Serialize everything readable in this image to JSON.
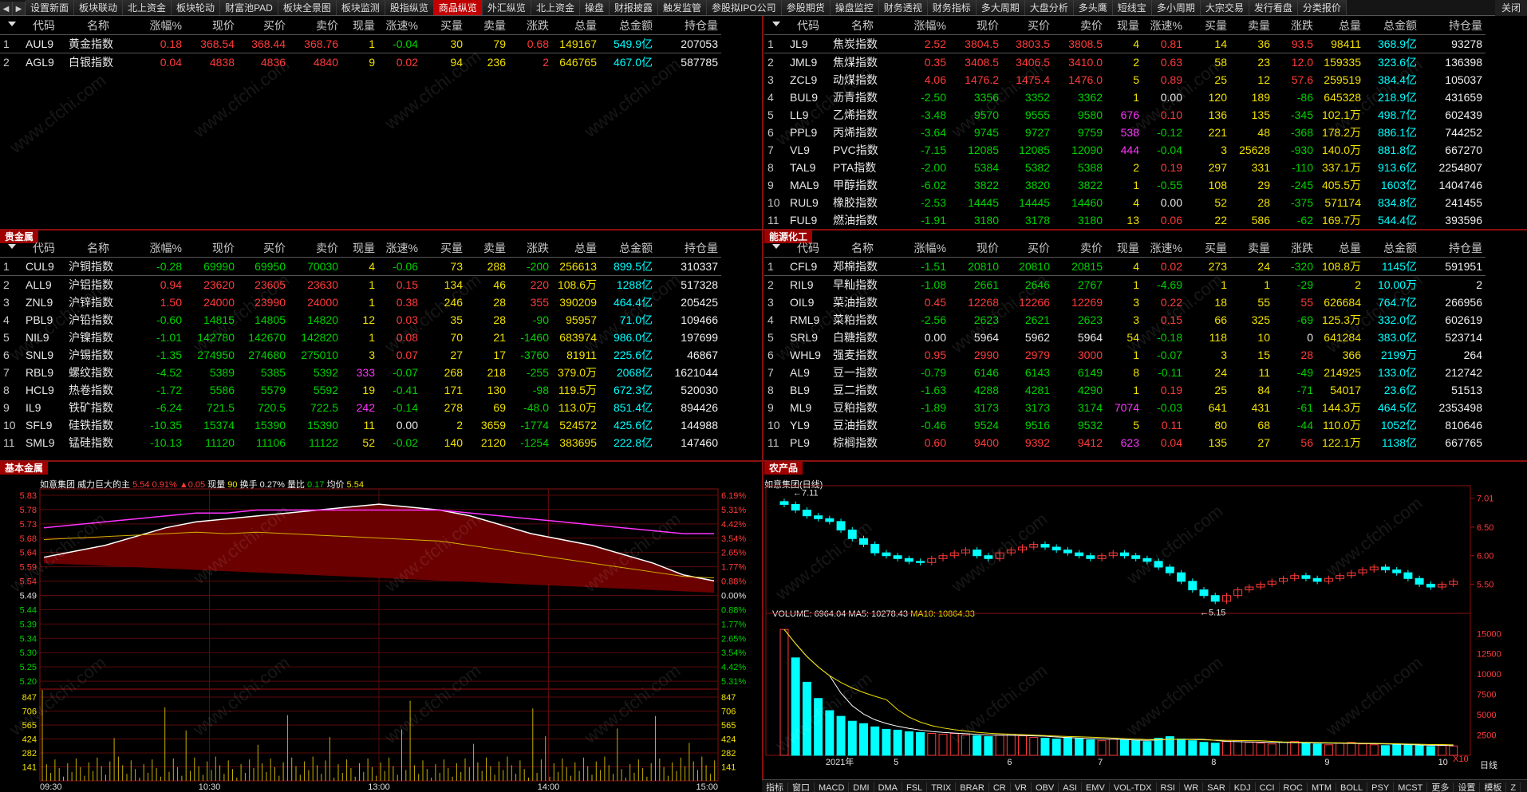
{
  "top_tabs": [
    "设置新面",
    "板块联动",
    "北上资金",
    "板块轮动",
    "财富池PAD",
    "板块全景图",
    "板块监测",
    "股指纵览",
    "商品纵览",
    "外汇纵览",
    "北上资金",
    "操盘",
    "财报披露",
    "触发监管",
    "参股拟IPO公司",
    "参股期货",
    "操盘监控",
    "财务透视",
    "财务指标",
    "多大周期",
    "大盘分析",
    "多头鹰",
    "短线宝",
    "多小周期",
    "大宗交易",
    "发行看盘",
    "分类报价"
  ],
  "active_tab": "商品纵览",
  "close_label": "关闭",
  "headers": {
    "idx": "",
    "code": "代码",
    "name": "名称",
    "chg_pct": "涨幅%",
    "price": "现价",
    "bid": "买价",
    "ask": "卖价",
    "vol_now": "现量",
    "speed": "涨速%",
    "buy_vol": "买量",
    "sell_vol": "卖量",
    "chg": "涨跌",
    "total_vol": "总量",
    "amount": "总金额",
    "oi": "持仓量"
  },
  "panels": {
    "gold": {
      "title": "",
      "rows": [
        [
          "1",
          "AUL9",
          "黄金指数",
          "0.18",
          "368.54",
          "368.44",
          "368.76",
          "1",
          "-0.04",
          "30",
          "79",
          "0.68",
          "149167",
          "549.9亿",
          "207053"
        ],
        [
          "2",
          "AGL9",
          "白银指数",
          "0.04",
          "4838",
          "4836",
          "4840",
          "9",
          "0.02",
          "94",
          "236",
          "2",
          "646765",
          "467.0亿",
          "587785"
        ]
      ]
    },
    "precious": {
      "title": "贵金属",
      "rows": [
        [
          "1",
          "CUL9",
          "沪铜指数",
          "-0.28",
          "69990",
          "69950",
          "70030",
          "4",
          "-0.06",
          "73",
          "288",
          "-200",
          "256613",
          "899.5亿",
          "310337"
        ],
        [
          "2",
          "ALL9",
          "沪铝指数",
          "0.94",
          "23620",
          "23605",
          "23630",
          "1",
          "0.15",
          "134",
          "46",
          "220",
          "108.6万",
          "1288亿",
          "517328"
        ],
        [
          "3",
          "ZNL9",
          "沪锌指数",
          "1.50",
          "24000",
          "23990",
          "24000",
          "1",
          "0.38",
          "246",
          "28",
          "355",
          "390209",
          "464.4亿",
          "205425"
        ],
        [
          "4",
          "PBL9",
          "沪铅指数",
          "-0.60",
          "14815",
          "14805",
          "14820",
          "12",
          "0.03",
          "35",
          "28",
          "-90",
          "95957",
          "71.0亿",
          "109466"
        ],
        [
          "5",
          "NIL9",
          "沪镍指数",
          "-1.01",
          "142780",
          "142670",
          "142820",
          "1",
          "0.08",
          "70",
          "21",
          "-1460",
          "683974",
          "986.0亿",
          "197699"
        ],
        [
          "6",
          "SNL9",
          "沪锡指数",
          "-1.35",
          "274950",
          "274680",
          "275010",
          "3",
          "0.07",
          "27",
          "17",
          "-3760",
          "81911",
          "225.6亿",
          "46867"
        ],
        [
          "7",
          "RBL9",
          "螺纹指数",
          "-4.52",
          "5389",
          "5385",
          "5392",
          "333",
          "-0.07",
          "268",
          "218",
          "-255",
          "379.0万",
          "2068亿",
          "1621044"
        ],
        [
          "8",
          "HCL9",
          "热卷指数",
          "-1.72",
          "5586",
          "5579",
          "5592",
          "19",
          "-0.41",
          "171",
          "130",
          "-98",
          "119.5万",
          "672.3亿",
          "520030"
        ],
        [
          "9",
          "IL9",
          "铁矿指数",
          "-6.24",
          "721.5",
          "720.5",
          "722.5",
          "242",
          "-0.14",
          "278",
          "69",
          "-48.0",
          "113.0万",
          "851.4亿",
          "894426"
        ],
        [
          "10",
          "SFL9",
          "硅铁指数",
          "-10.35",
          "15374",
          "15390",
          "15390",
          "11",
          "0.00",
          "2",
          "3659",
          "-1774",
          "524572",
          "425.6亿",
          "144988"
        ],
        [
          "11",
          "SML9",
          "锰硅指数",
          "-10.13",
          "11120",
          "11106",
          "11122",
          "52",
          "-0.02",
          "140",
          "2120",
          "-1254",
          "383695",
          "222.8亿",
          "147460"
        ]
      ]
    },
    "energy": {
      "title": "",
      "rows": [
        [
          "1",
          "JL9",
          "焦炭指数",
          "2.52",
          "3804.5",
          "3803.5",
          "3808.5",
          "4",
          "0.81",
          "14",
          "36",
          "93.5",
          "98411",
          "368.9亿",
          "93278"
        ],
        [
          "2",
          "JML9",
          "焦煤指数",
          "0.35",
          "3408.5",
          "3406.5",
          "3410.0",
          "2",
          "0.63",
          "58",
          "23",
          "12.0",
          "159335",
          "323.6亿",
          "136398"
        ],
        [
          "3",
          "ZCL9",
          "动煤指数",
          "4.06",
          "1476.2",
          "1475.4",
          "1476.0",
          "5",
          "0.89",
          "25",
          "12",
          "57.6",
          "259519",
          "384.4亿",
          "105037"
        ],
        [
          "4",
          "BUL9",
          "沥青指数",
          "-2.50",
          "3356",
          "3352",
          "3362",
          "1",
          "0.00",
          "120",
          "189",
          "-86",
          "645328",
          "218.9亿",
          "431659"
        ],
        [
          "5",
          "LL9",
          "乙烯指数",
          "-3.48",
          "9570",
          "9555",
          "9580",
          "676",
          "0.10",
          "136",
          "135",
          "-345",
          "102.1万",
          "498.7亿",
          "602439"
        ],
        [
          "6",
          "PPL9",
          "丙烯指数",
          "-3.64",
          "9745",
          "9727",
          "9759",
          "538",
          "-0.12",
          "221",
          "48",
          "-368",
          "178.2万",
          "886.1亿",
          "744252"
        ],
        [
          "7",
          "VL9",
          "PVC指数",
          "-7.15",
          "12085",
          "12085",
          "12090",
          "444",
          "-0.04",
          "3",
          "25628",
          "-930",
          "140.0万",
          "881.8亿",
          "667270"
        ],
        [
          "8",
          "TAL9",
          "PTA指数",
          "-2.00",
          "5384",
          "5382",
          "5388",
          "2",
          "0.19",
          "297",
          "331",
          "-110",
          "337.1万",
          "913.6亿",
          "2254807"
        ],
        [
          "9",
          "MAL9",
          "甲醇指数",
          "-6.02",
          "3822",
          "3820",
          "3822",
          "1",
          "-0.55",
          "108",
          "29",
          "-245",
          "405.5万",
          "1603亿",
          "1404746"
        ],
        [
          "10",
          "RUL9",
          "橡胶指数",
          "-2.53",
          "14445",
          "14445",
          "14460",
          "4",
          "0.00",
          "52",
          "28",
          "-375",
          "571174",
          "834.8亿",
          "241455"
        ],
        [
          "11",
          "FUL9",
          "燃油指数",
          "-1.91",
          "3180",
          "3178",
          "3180",
          "13",
          "0.06",
          "22",
          "586",
          "-62",
          "169.7万",
          "544.4亿",
          "393596"
        ]
      ]
    },
    "chem": {
      "title": "能源化工",
      "rows": [
        [
          "1",
          "CFL9",
          "郑棉指数",
          "-1.51",
          "20810",
          "20810",
          "20815",
          "4",
          "0.02",
          "273",
          "24",
          "-320",
          "108.8万",
          "1145亿",
          "591951"
        ],
        [
          "2",
          "RIL9",
          "早籼指数",
          "-1.08",
          "2661",
          "2646",
          "2767",
          "1",
          "-4.69",
          "1",
          "1",
          "-29",
          "2",
          "10.00万",
          "2"
        ],
        [
          "3",
          "OIL9",
          "菜油指数",
          "0.45",
          "12268",
          "12266",
          "12269",
          "3",
          "0.22",
          "18",
          "55",
          "55",
          "626684",
          "764.7亿",
          "266956"
        ],
        [
          "4",
          "RML9",
          "菜粕指数",
          "-2.56",
          "2623",
          "2621",
          "2623",
          "3",
          "0.15",
          "66",
          "325",
          "-69",
          "125.3万",
          "332.0亿",
          "602619"
        ],
        [
          "5",
          "SRL9",
          "白糖指数",
          "0.00",
          "5964",
          "5962",
          "5964",
          "54",
          "-0.18",
          "118",
          "10",
          "0",
          "641284",
          "383.0亿",
          "523714"
        ],
        [
          "6",
          "WHL9",
          "强麦指数",
          "0.95",
          "2990",
          "2979",
          "3000",
          "1",
          "-0.07",
          "3",
          "15",
          "28",
          "366",
          "2199万",
          "264"
        ],
        [
          "7",
          "AL9",
          "豆一指数",
          "-0.79",
          "6146",
          "6143",
          "6149",
          "8",
          "-0.11",
          "24",
          "11",
          "-49",
          "214925",
          "133.0亿",
          "212742"
        ],
        [
          "8",
          "BL9",
          "豆二指数",
          "-1.63",
          "4288",
          "4281",
          "4290",
          "1",
          "0.19",
          "25",
          "84",
          "-71",
          "54017",
          "23.6亿",
          "51513"
        ],
        [
          "9",
          "ML9",
          "豆粕指数",
          "-1.89",
          "3173",
          "3173",
          "3174",
          "7074",
          "-0.03",
          "641",
          "431",
          "-61",
          "144.3万",
          "464.5亿",
          "2353498"
        ],
        [
          "10",
          "YL9",
          "豆油指数",
          "-0.46",
          "9524",
          "9516",
          "9532",
          "5",
          "0.11",
          "80",
          "68",
          "-44",
          "110.0万",
          "1052亿",
          "810646"
        ],
        [
          "11",
          "PL9",
          "棕榈指数",
          "0.60",
          "9400",
          "9392",
          "9412",
          "623",
          "0.04",
          "135",
          "27",
          "56",
          "122.1万",
          "1138亿",
          "667765"
        ]
      ]
    }
  },
  "intraday": {
    "title": "基本金属",
    "info_name": "如意集团",
    "info_tag": "威力巨大的主",
    "info_price": "5.54",
    "info_pct": "0.91%",
    "info_chg": "▲0.05",
    "info_vol_label": "现量",
    "info_vol": "90",
    "info_turn_label": "换手",
    "info_turn": "0.27%",
    "info_ratio_label": "量比",
    "info_ratio": "0.17",
    "info_avg_label": "均价",
    "info_avg": "5.54",
    "left_prices": [
      "5.83",
      "5.78",
      "5.73",
      "5.68",
      "5.64",
      "5.59",
      "5.54",
      "5.49",
      "5.44",
      "5.39",
      "5.34",
      "5.30",
      "5.25",
      "5.20"
    ],
    "right_pcts": [
      "6.19%",
      "5.31%",
      "4.42%",
      "3.54%",
      "2.65%",
      "1.77%",
      "0.88%",
      "0.00%",
      "0.88%",
      "1.77%",
      "2.65%",
      "3.54%",
      "4.42%",
      "5.31%"
    ],
    "vol_left": [
      "847",
      "706",
      "565",
      "424",
      "282",
      "141"
    ],
    "vol_right": [
      "847",
      "706",
      "565",
      "424",
      "282",
      "141"
    ],
    "times": [
      "09:30",
      "10:30",
      "13:00",
      "14:00",
      "15:00"
    ],
    "price_series": [
      5.62,
      5.64,
      5.66,
      5.69,
      5.72,
      5.74,
      5.75,
      5.76,
      5.77,
      5.78,
      5.79,
      5.8,
      5.79,
      5.78,
      5.76,
      5.73,
      5.7,
      5.68,
      5.66,
      5.63,
      5.6,
      5.56,
      5.54
    ],
    "avg_series": [
      5.72,
      5.73,
      5.74,
      5.75,
      5.76,
      5.77,
      5.77,
      5.78,
      5.78,
      5.78,
      5.78,
      5.78,
      5.78,
      5.78,
      5.77,
      5.76,
      5.75,
      5.74,
      5.73,
      5.72,
      5.71,
      5.7,
      5.7
    ]
  },
  "kline": {
    "title": "农产品",
    "info": "如意集团(日线)",
    "price_labels": [
      "7.01",
      "6.50",
      "6.00",
      "5.50"
    ],
    "annot_high": "7.11",
    "annot_low": "5.15",
    "vol_header": "VOLUME: 6964.04",
    "ma5_label": "MA5: 10278.43",
    "ma10_label": "MA10: 10864.33",
    "vol_labels": [
      "15000",
      "12500",
      "10000",
      "7500",
      "5000",
      "2500"
    ],
    "x_labels": [
      "2021年",
      "5",
      "6",
      "7",
      "8",
      "9",
      "10"
    ],
    "x10": "X10",
    "period": "日线",
    "closes": [
      6.9,
      6.8,
      6.7,
      6.65,
      6.6,
      6.45,
      6.3,
      6.2,
      6.05,
      6.0,
      5.95,
      5.9,
      5.88,
      5.95,
      6.0,
      6.05,
      6.1,
      6.0,
      5.95,
      6.05,
      6.1,
      6.15,
      6.2,
      6.15,
      6.1,
      6.05,
      6.0,
      5.95,
      6.0,
      6.05,
      6.0,
      5.95,
      5.9,
      5.8,
      5.7,
      5.55,
      5.4,
      5.3,
      5.2,
      5.3,
      5.4,
      5.45,
      5.5,
      5.55,
      5.6,
      5.65,
      5.6,
      5.55,
      5.6,
      5.65,
      5.7,
      5.75,
      5.8,
      5.75,
      5.7,
      5.6,
      5.5,
      5.45,
      5.5,
      5.55
    ],
    "volumes": [
      15500,
      12000,
      9000,
      7000,
      5500,
      4800,
      4200,
      3900,
      3500,
      3200,
      3100,
      2900,
      2800,
      2700,
      2600,
      2700,
      2500,
      2400,
      2300,
      2500,
      2600,
      2400,
      2200,
      2100,
      2000,
      2200,
      2100,
      1900,
      1800,
      2000,
      1900,
      1800,
      1700,
      2100,
      2300,
      2000,
      1800,
      1600,
      1500,
      1700,
      1800,
      1600,
      1500,
      1400,
      1600,
      1700,
      1500,
      1400,
      1300,
      1500,
      1600,
      1400,
      1300,
      1200,
      1400,
      1300,
      1200,
      1100,
      1200,
      1150
    ]
  },
  "bottom_tabs": [
    "指标",
    "窗口",
    "MACD",
    "DMI",
    "DMA",
    "FSL",
    "TRIX",
    "BRAR",
    "CR",
    "VR",
    "OBV",
    "ASI",
    "EMV",
    "VOL-TDX",
    "RSI",
    "WR",
    "SAR",
    "KDJ",
    "CCI",
    "ROC",
    "MTM",
    "BOLL",
    "PSY",
    "MCST",
    "更多",
    "设置",
    "模板",
    "Z"
  ],
  "watermark": "www.cfchi.com"
}
